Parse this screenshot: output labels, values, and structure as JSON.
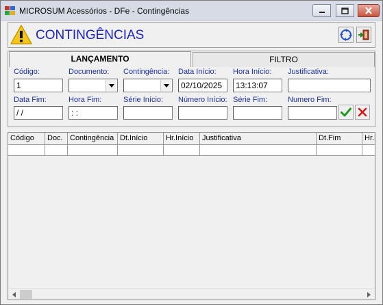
{
  "window": {
    "title": "MICROSUM Acessórios - DFe - Contingências"
  },
  "header": {
    "title": "CONTINGÊNCIAS"
  },
  "tabs": [
    {
      "label": "LANÇAMENTO",
      "active": true
    },
    {
      "label": "FILTRO",
      "active": false
    }
  ],
  "form": {
    "codigo": {
      "label": "Código:",
      "value": "1"
    },
    "documento": {
      "label": "Documento:",
      "value": ""
    },
    "contingencia": {
      "label": "Contingência:",
      "value": ""
    },
    "data_inicio": {
      "label": "Data Início:",
      "value": "02/10/2025"
    },
    "hora_inicio": {
      "label": "Hora Início:",
      "value": "13:13:07"
    },
    "justificativa": {
      "label": "Justificativa:",
      "value": ""
    },
    "data_fim": {
      "label": "Data Fim:",
      "value": " / /"
    },
    "hora_fim": {
      "label": "Hora Fim:",
      "value": " : :"
    },
    "serie_inicio": {
      "label": "Série Início:",
      "value": ""
    },
    "numero_inicio": {
      "label": "Número Início:",
      "value": ""
    },
    "serie_fim": {
      "label": "Série Fim:",
      "value": ""
    },
    "numero_fim": {
      "label": "Numero Fim:",
      "value": ""
    }
  },
  "grid": {
    "columns": [
      "Código",
      "Doc.",
      "Contingência",
      "Dt.Início",
      "Hr.Início",
      "Justificativa",
      "Dt.Fim",
      "Hr.F"
    ]
  },
  "colors": {
    "label_blue": "#1c2fa8",
    "title_blue": "#1a22c8",
    "confirm_green": "#1f9a1f",
    "cancel_red": "#d21a1a"
  },
  "icons": [
    "app-icon",
    "warning-icon",
    "refresh-icon",
    "exit-door-icon",
    "check-icon",
    "x-icon"
  ]
}
